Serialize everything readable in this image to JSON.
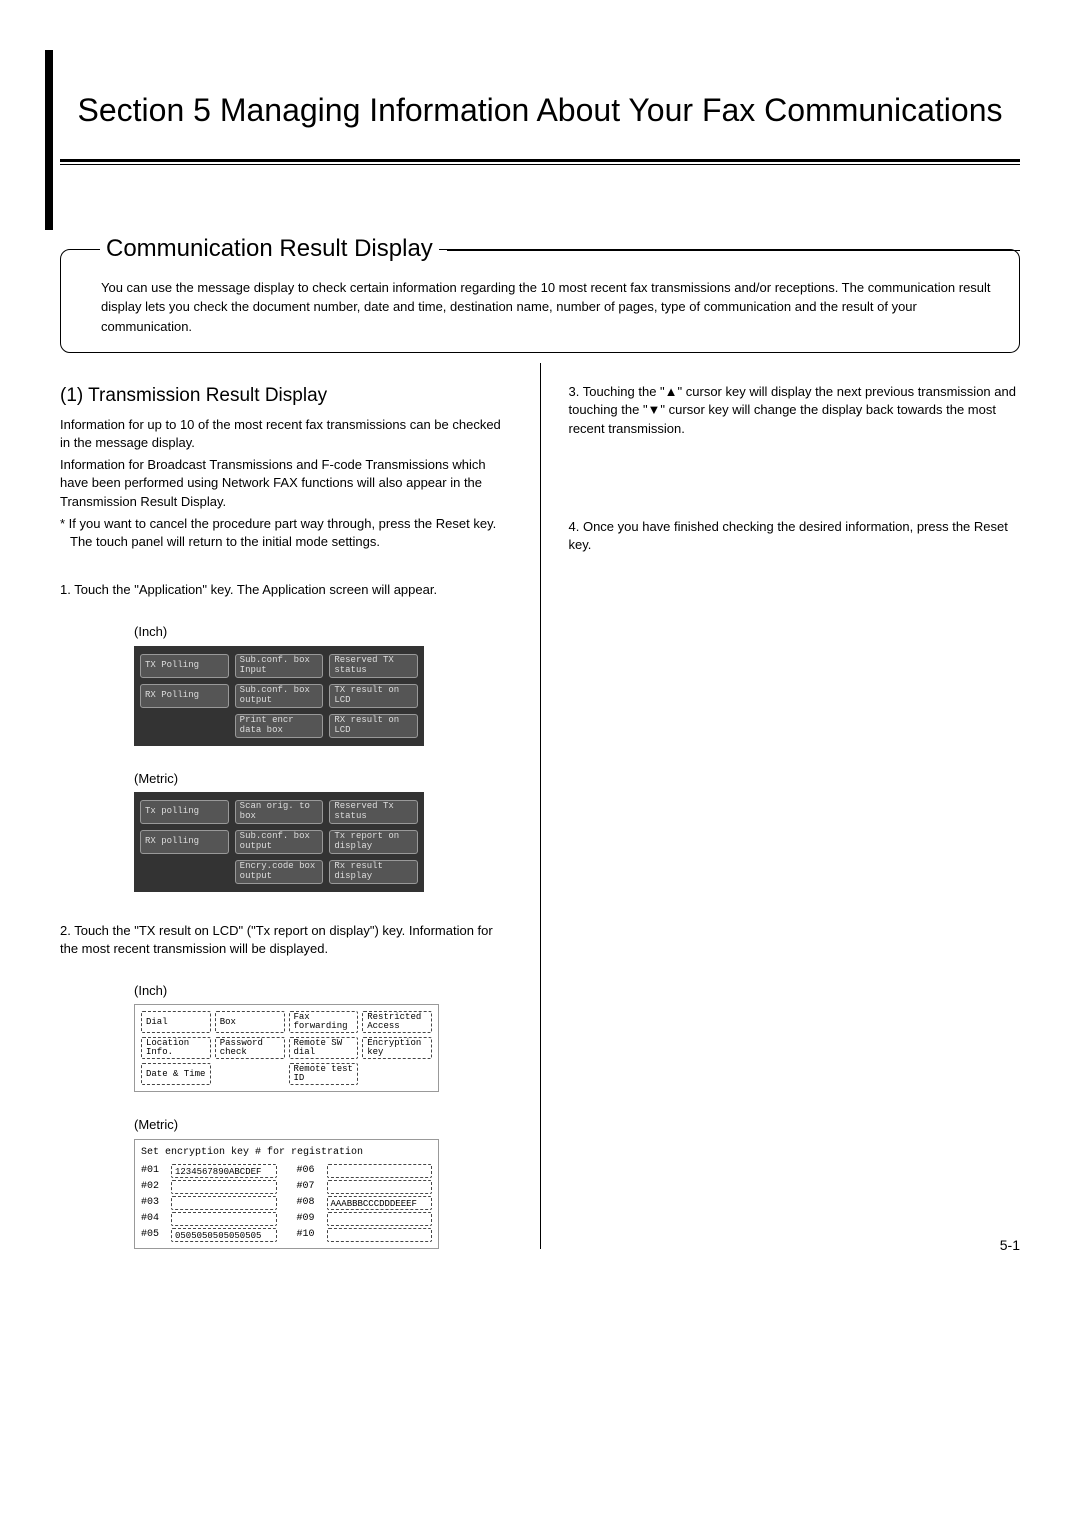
{
  "section_title": "Section 5  Managing Information About Your Fax Communications",
  "comm_result": {
    "title": "Communication Result Display",
    "intro": "You can use the message display to check certain information regarding the 10 most recent fax transmissions and/or receptions. The communication result display lets you check the document number, date and time, destination name, number of pages, type of communication and the result of your communication."
  },
  "left": {
    "subhead": "(1) Transmission Result Display",
    "p1": "Information for up to 10 of the most recent fax transmissions can be checked in the message display.",
    "p2": "Information for Broadcast Transmissions and F-code Transmissions which have been performed using Network FAX functions will also appear in the Transmission Result Display.",
    "note": "* If you want to cancel the procedure part way through, press the Reset key. The touch panel will return to the initial mode settings.",
    "step1": "1. Touch the \"Application\" key. The Application screen will appear.",
    "step2": "2. Touch the \"TX result on LCD\" (\"Tx report on display\") key. Information for the most recent transmission will be displayed.",
    "labels": {
      "inch": "(Inch)",
      "metric": "(Metric)"
    },
    "app_inch": {
      "r1": [
        "TX Polling",
        "Sub.conf. box Input",
        "Reserved TX status"
      ],
      "r2": [
        "RX Polling",
        "Sub.conf. box output",
        "TX result on LCD"
      ],
      "r3": [
        "",
        "Print encr data box",
        "RX result on LCD"
      ]
    },
    "app_metric": {
      "r1": [
        "Tx polling",
        "Scan orig. to box",
        "Reserved Tx status"
      ],
      "r2": [
        "RX polling",
        "Sub.conf. box output",
        "Tx report on display"
      ],
      "r3": [
        "",
        "Encry.code box output",
        "Rx result display"
      ]
    },
    "res_inch": {
      "r1": [
        "Dial",
        "Box",
        "Fax forwarding",
        "Restricted Access"
      ],
      "r2": [
        "Location Info.",
        "Password check",
        "Remote SW dial",
        "Encryption key"
      ],
      "r3": [
        "Date & Time",
        "",
        "Remote test ID",
        ""
      ]
    },
    "enc": {
      "title": "Set encryption key # for registration",
      "left_ids": [
        "#01",
        "#02",
        "#03",
        "#04",
        "#05"
      ],
      "left_vals": [
        "1234567890ABCDEF",
        "",
        "",
        "",
        "0505050505050505"
      ],
      "right_ids": [
        "#06",
        "#07",
        "#08",
        "#09",
        "#10"
      ],
      "right_vals": [
        "",
        "",
        "AAABBBCCCDDDEEEF",
        "",
        ""
      ]
    }
  },
  "right": {
    "step3": "3. Touching the \"▲\" cursor key will display the next previous transmission and touching the \"▼\" cursor key will change the display back towards the most recent transmission.",
    "step4": "4. Once you have finished checking the desired information, press the Reset key."
  },
  "page_number": "5-1"
}
